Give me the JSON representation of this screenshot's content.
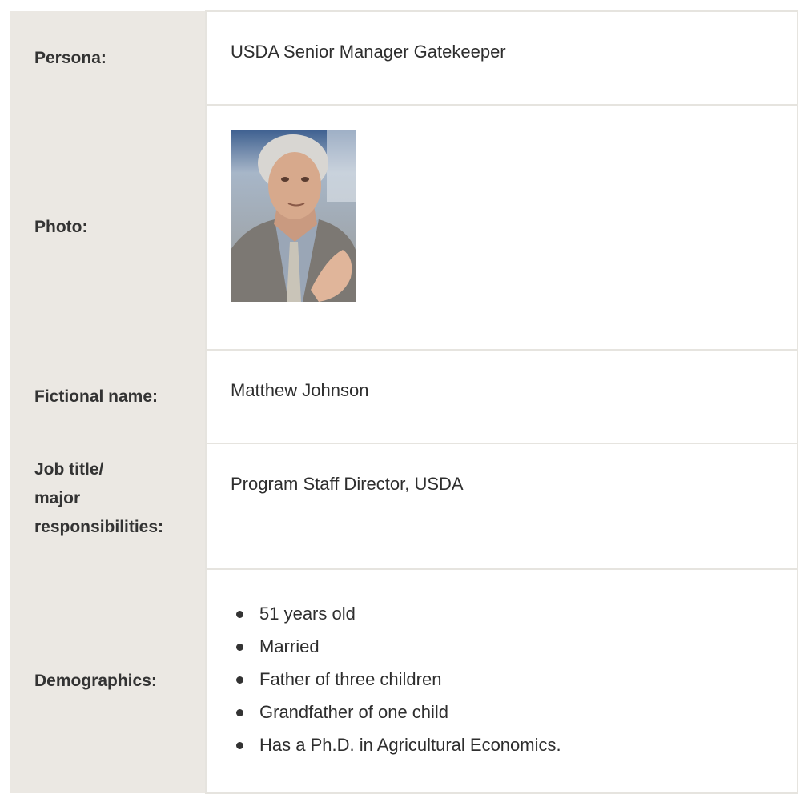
{
  "rows": {
    "persona": {
      "label": "Persona:",
      "value": "USDA Senior Manager Gatekeeper"
    },
    "photo": {
      "label": "Photo:",
      "image": "portrait-photo-older-man-in-suit-gesturing"
    },
    "name": {
      "label": "Fictional name:",
      "value": "Matthew Johnson"
    },
    "job": {
      "label_lines": [
        "Job title/",
        "major",
        "responsibilities:"
      ],
      "value": "Program Staff Director, USDA"
    },
    "demographics": {
      "label": "Demographics:",
      "items": [
        "51 years old",
        "Married",
        "Father of three children",
        "Grandfather of one child",
        "Has a Ph.D. in Agricultural Economics."
      ]
    }
  },
  "colors": {
    "label_background": "#ebe8e3",
    "border": "#e6e4df",
    "text": "#2e2e2e"
  }
}
